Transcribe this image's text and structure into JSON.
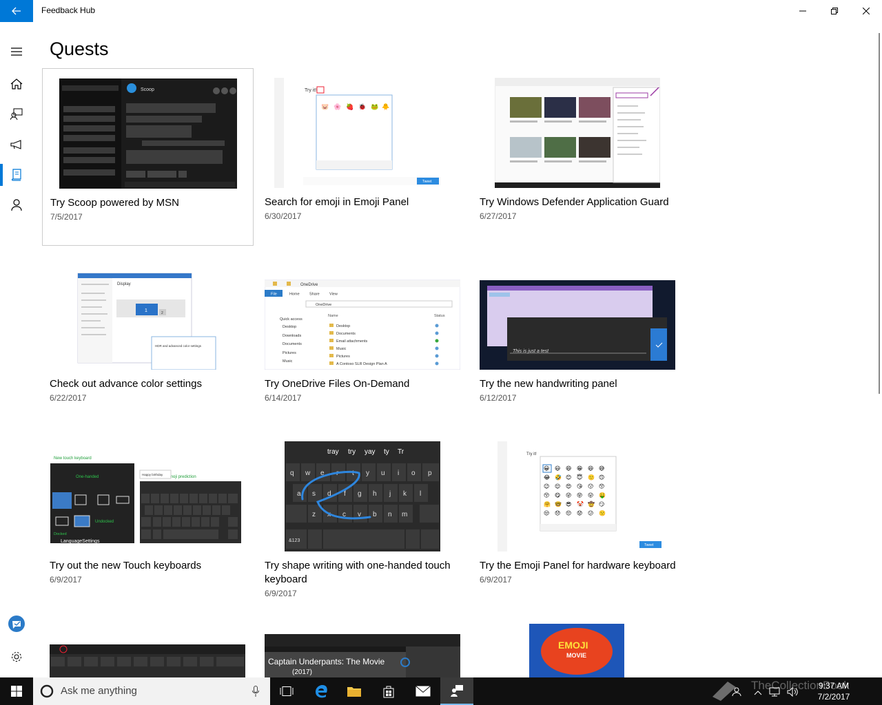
{
  "window": {
    "title": "Feedback Hub"
  },
  "nav": {
    "items": [
      {
        "name": "menu",
        "label": "Menu"
      },
      {
        "name": "home",
        "label": "Home"
      },
      {
        "name": "feedback",
        "label": "Feedback"
      },
      {
        "name": "announcements",
        "label": "Announcements"
      },
      {
        "name": "quests",
        "label": "Quests",
        "selected": true
      },
      {
        "name": "achievements",
        "label": "Achievements"
      }
    ],
    "bottom": [
      {
        "name": "insider",
        "label": "Windows Insider"
      },
      {
        "name": "settings",
        "label": "Settings"
      }
    ]
  },
  "page": {
    "title": "Quests"
  },
  "quests": [
    {
      "title": "Try Scoop powered by MSN",
      "date": "7/5/2017",
      "thumb": "Scoop app screenshot"
    },
    {
      "title": "Search for emoji in Emoji Panel",
      "date": "6/30/2017",
      "thumb": "Emoji panel screenshot"
    },
    {
      "title": "Try Windows Defender Application Guard",
      "date": "6/27/2017",
      "thumb": "Edge browser screenshot"
    },
    {
      "title": "Check out advance color settings",
      "date": "6/22/2017",
      "thumb": "Display settings screenshot"
    },
    {
      "title": "Try OneDrive Files On-Demand",
      "date": "6/14/2017",
      "thumb": "OneDrive explorer screenshot"
    },
    {
      "title": "Try the new handwriting panel",
      "date": "6/12/2017",
      "thumb": "Handwriting panel screenshot"
    },
    {
      "title": "Try out the new Touch keyboards",
      "date": "6/9/2017",
      "thumb": "Touch keyboards screenshot"
    },
    {
      "title": "Try shape writing with one-handed touch keyboard",
      "date": "6/9/2017",
      "thumb": "Shape writing keyboard screenshot"
    },
    {
      "title": "Try the Emoji Panel for hardware keyboard",
      "date": "6/9/2017",
      "thumb": "Emoji panel grid screenshot"
    }
  ],
  "thumb_text": {
    "scoop_app": "Scoop",
    "emoji_try": "Try it!",
    "emoji_tweet": "Tweet",
    "onedrive_title": "OneDrive",
    "onedrive_tabs": [
      "File",
      "Home",
      "Share",
      "View"
    ],
    "onedrive_path": "OneDrive",
    "onedrive_quick": "Quick access",
    "onedrive_side": [
      "Desktop",
      "Downloads",
      "Documents",
      "Pictures",
      "Music"
    ],
    "onedrive_name_col": "Name",
    "onedrive_status_col": "Status",
    "onedrive_files": [
      "Desktop",
      "Documents",
      "Email attachments",
      "Music",
      "Pictures",
      "A Contoso SLR Design Plan A"
    ],
    "display_title": "Display",
    "display_num": "1",
    "display_num2": "2",
    "hdr_label": "HDR and advanced color settings",
    "handwriting_text": "This is just a test",
    "kb_new": "New touch keyboard",
    "kb_onehanded": "One-handed",
    "kb_undocked": "Undocked",
    "kb_docked": "Docked",
    "kb_langsettings": "LanguageSettings",
    "kb_emoji_pred": "Emoji prediction",
    "kb_happy": "Happy birthday",
    "shape_suggestions": [
      "tray",
      "try",
      "yay",
      "ty",
      "Tr"
    ],
    "shape_row1": [
      "q",
      "w",
      "e",
      "r",
      "t",
      "y",
      "u",
      "i",
      "o",
      "p"
    ],
    "shape_row2": [
      "a",
      "s",
      "d",
      "f",
      "g",
      "h",
      "j",
      "k",
      "l"
    ],
    "shape_row3": [
      "z",
      "x",
      "c",
      "v",
      "b",
      "n",
      "m"
    ],
    "shape_sym": "&123",
    "movie_title": "Captain Underpants: The Movie",
    "movie_year": "(2017)",
    "emoji_movie_logo": "EMOJI",
    "emoji_movie_sub": "MOVIE"
  },
  "taskbar": {
    "search_placeholder": "Ask me anything",
    "time": "9:37 AM",
    "date": "7/2/2017",
    "watermark": "TheCollectionBook"
  },
  "colors": {
    "accent": "#0078d7",
    "taskbar": "#101010"
  }
}
